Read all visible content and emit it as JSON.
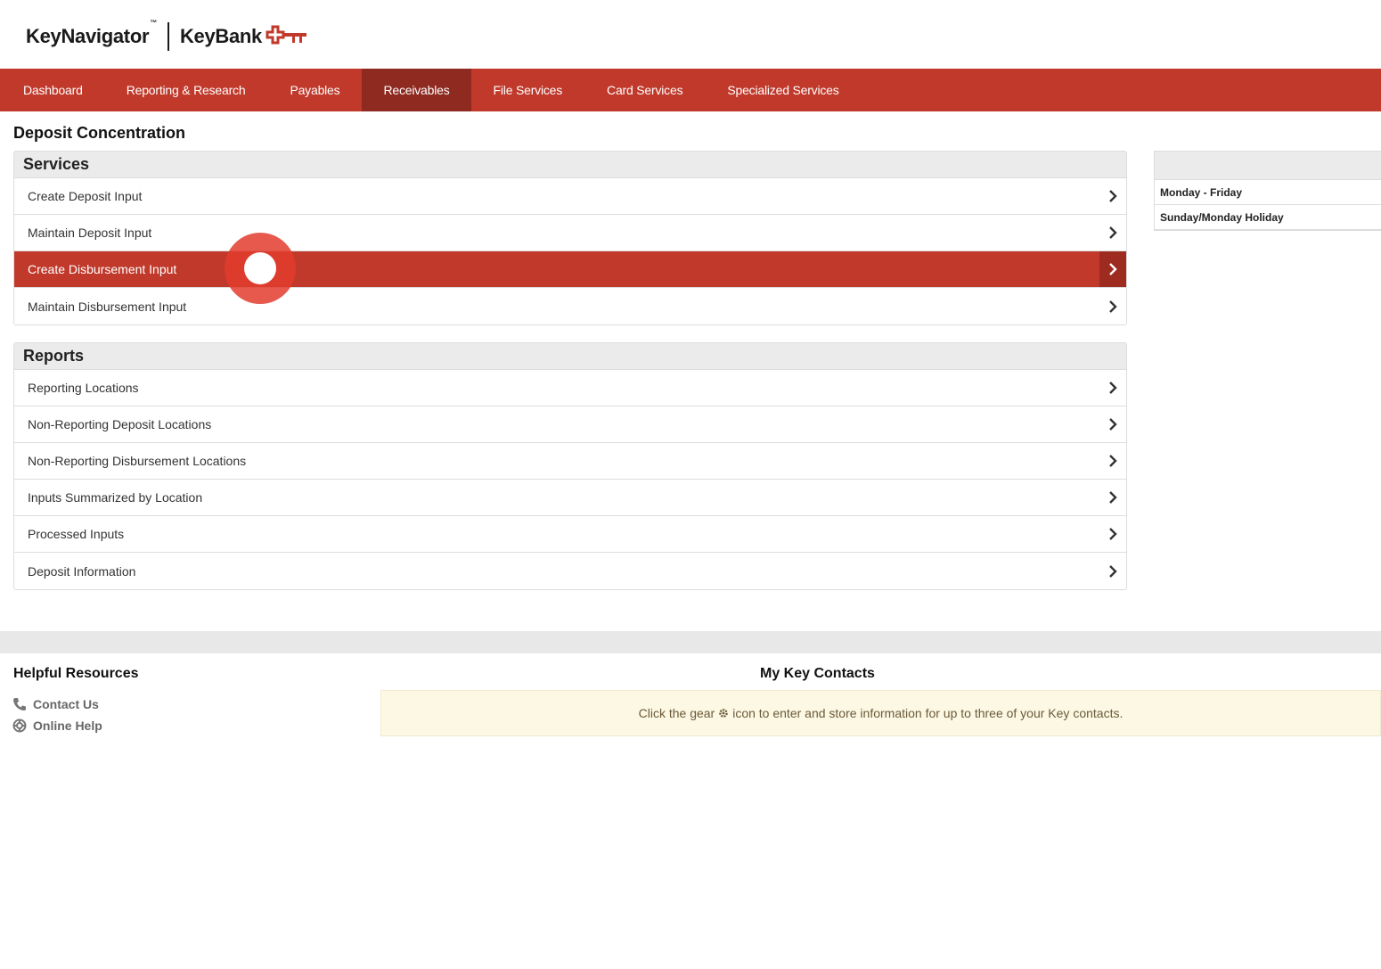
{
  "header": {
    "brand_primary": "KeyNavigator",
    "brand_tm": "™",
    "brand_secondary": "KeyBank"
  },
  "nav": {
    "items": [
      {
        "label": "Dashboard",
        "active": false
      },
      {
        "label": "Reporting & Research",
        "active": false
      },
      {
        "label": "Payables",
        "active": false
      },
      {
        "label": "Receivables",
        "active": true
      },
      {
        "label": "File Services",
        "active": false
      },
      {
        "label": "Card Services",
        "active": false
      },
      {
        "label": "Specialized Services",
        "active": false
      }
    ]
  },
  "page": {
    "title": "Deposit Concentration"
  },
  "services": {
    "heading": "Services",
    "items": [
      {
        "label": "Create Deposit Input"
      },
      {
        "label": "Maintain Deposit Input"
      },
      {
        "label": "Create Disbursement Input",
        "selected": true
      },
      {
        "label": "Maintain Disbursement Input"
      }
    ]
  },
  "reports": {
    "heading": "Reports",
    "items": [
      {
        "label": "Reporting Locations"
      },
      {
        "label": "Non-Reporting Deposit Locations"
      },
      {
        "label": "Non-Reporting Disbursement Locations"
      },
      {
        "label": "Inputs Summarized by Location"
      },
      {
        "label": "Processed Inputs"
      },
      {
        "label": "Deposit Information"
      }
    ]
  },
  "hours": {
    "rows": [
      "Monday - Friday",
      "Sunday/Monday Holiday"
    ]
  },
  "resources": {
    "title": "Helpful Resources",
    "contact_us": "Contact Us",
    "online_help": "Online Help"
  },
  "contacts": {
    "title": "My Key Contacts",
    "message_before": "Click the gear",
    "message_after": "icon to enter and store information for up to three of your Key contacts."
  },
  "colors": {
    "brand_red": "#c0392b",
    "active_nav": "#8e2a20",
    "notice_bg": "#fcf8e3"
  }
}
